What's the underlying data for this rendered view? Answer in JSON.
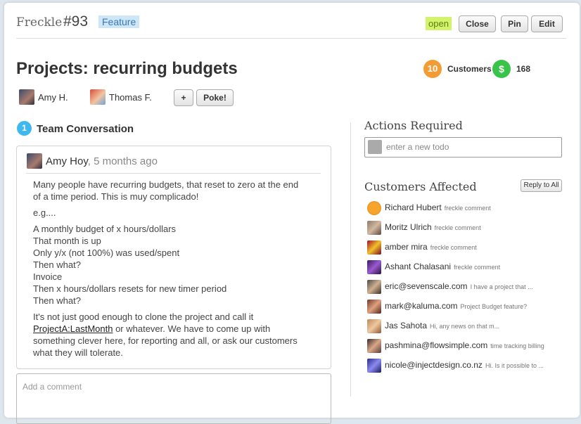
{
  "header": {
    "app_name": "Freckle",
    "issue_number": "#93",
    "label": "Feature",
    "status": "open",
    "buttons": {
      "close": "Close",
      "pin": "Pin",
      "edit": "Edit"
    }
  },
  "issue": {
    "title": "Projects: recurring budgets",
    "customers_count": "10",
    "customers_label": "Customers",
    "dollar_icon": "$",
    "revenue": "168"
  },
  "participants": [
    {
      "name": "Amy H."
    },
    {
      "name": "Thomas F."
    }
  ],
  "actions": {
    "add": "+",
    "poke": "Poke!"
  },
  "conversation": {
    "count": "1",
    "title": "Team Conversation",
    "author": "Amy Hoy",
    "time": ", 5 months ago",
    "paragraphs": [
      "Many people have recurring budgets, that reset to zero at the end of a time period. This is muy complicado!",
      "e.g....",
      "A monthly budget of x hours/dollars",
      "That month is up",
      "Only y/x (not 100%) was used/spent",
      "Then what?",
      "Invoice",
      "Then x hours/dollars resets for new timer period",
      "Then what?"
    ],
    "last_pre": "It's not just good enough to clone the project and call it ",
    "link": "ProjectA:LastMonth",
    "last_post": " or whatever. We have to come up with something clever here, for reporting and all, or ask our customers what they will tolerate."
  },
  "comment": {
    "placeholder": "Add a comment"
  },
  "sidebar": {
    "actions_title": "Actions Required",
    "todo_placeholder": "enter a new todo",
    "customers_title": "Customers Affected",
    "reply_all": "Reply to All",
    "customers": [
      {
        "name": "Richard Hubert",
        "note": "freckle comment"
      },
      {
        "name": "Moritz Ulrich",
        "note": "freckle comment"
      },
      {
        "name": "amber mira",
        "note": "freckle comment"
      },
      {
        "name": "Ashant Chalasani",
        "note": "freckle comment"
      },
      {
        "name": "eric@sevenscale.com",
        "note": "I have a project that ..."
      },
      {
        "name": "mark@kaluma.com",
        "note": "Project Budget feature?"
      },
      {
        "name": "Jas Sahota",
        "note": "Hi, any news on that m..."
      },
      {
        "name": "pashmina@flowsimple.com",
        "note": "time tracking billing"
      },
      {
        "name": "nicole@injectdesign.co.nz",
        "note": "Hi. Is it possible to ..."
      }
    ]
  }
}
